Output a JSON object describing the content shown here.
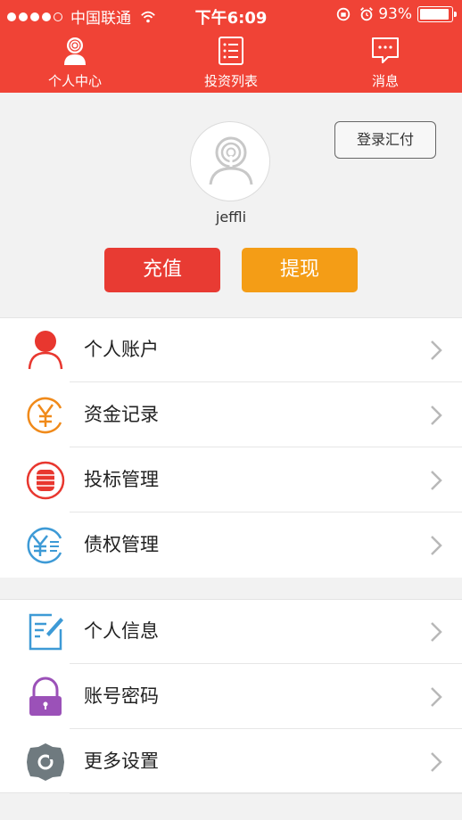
{
  "status_bar": {
    "carrier": "中国联通",
    "time": "下午6:09",
    "battery": "93%",
    "battery_level": 0.93
  },
  "nav_tabs": [
    {
      "label": "个人中心",
      "icon": "user-center-icon"
    },
    {
      "label": "投资列表",
      "icon": "list-icon"
    },
    {
      "label": "消息",
      "icon": "message-icon"
    }
  ],
  "profile": {
    "login_button": "登录汇付",
    "username": "jeffli",
    "recharge_button": "充值",
    "withdraw_button": "提现"
  },
  "menu_group_1": [
    {
      "label": "个人账户",
      "icon": "person-icon"
    },
    {
      "label": "资金记录",
      "icon": "yuan-icon"
    },
    {
      "label": "投标管理",
      "icon": "coin-stack-icon"
    },
    {
      "label": "债权管理",
      "icon": "yuan-list-icon"
    }
  ],
  "menu_group_2": [
    {
      "label": "个人信息",
      "icon": "edit-icon"
    },
    {
      "label": "账号密码",
      "icon": "lock-icon"
    },
    {
      "label": "更多设置",
      "icon": "gear-icon"
    }
  ],
  "colors": {
    "header": "#f04336",
    "recharge": "#e83b33",
    "withdraw": "#f49d16"
  }
}
